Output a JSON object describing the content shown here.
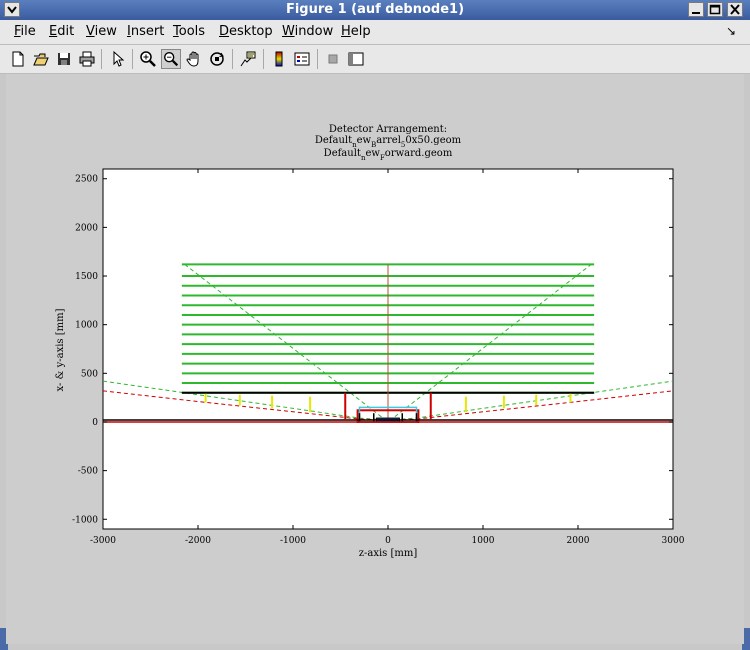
{
  "window": {
    "title": "Figure 1 (auf debnode1)",
    "menu_glyph": "❯",
    "min_glyph": "▁",
    "max_glyph": "☐",
    "close_glyph": "✕"
  },
  "menubar": {
    "items": [
      {
        "first": "F",
        "rest": "ile"
      },
      {
        "first": "E",
        "rest": "dit"
      },
      {
        "first": "V",
        "rest": "iew"
      },
      {
        "first": "I",
        "rest": "nsert"
      },
      {
        "first": "T",
        "rest": "ools"
      },
      {
        "first": "D",
        "rest": "esktop"
      },
      {
        "first": "W",
        "rest": "indow"
      },
      {
        "first": "H",
        "rest": "elp"
      }
    ],
    "dock_glyph": "↘"
  },
  "toolbar": {
    "icons": [
      "new-file-icon",
      "open-file-icon",
      "save-icon",
      "print-icon",
      "pointer-icon",
      "zoom-in-icon",
      "zoom-out-icon",
      "pan-hand-icon",
      "rotate-3d-icon",
      "data-cursor-icon",
      "colorbar-icon",
      "legend-icon",
      "hide-tools-icon",
      "plot-tools-icon"
    ]
  },
  "plot": {
    "title_line1": "Detector Arrangement:",
    "title_line2_parts": [
      {
        "t": "Default"
      },
      {
        "t": "n",
        "sub": true
      },
      {
        "t": "ew"
      },
      {
        "t": "B",
        "sub": true
      },
      {
        "t": "arrel"
      },
      {
        "t": "5",
        "sub": true
      },
      {
        "t": "0x50.geom"
      }
    ],
    "title_line3_parts": [
      {
        "t": "Default"
      },
      {
        "t": "n",
        "sub": true
      },
      {
        "t": "ew"
      },
      {
        "t": "F",
        "sub": true
      },
      {
        "t": "orward.geom"
      }
    ],
    "xlabel": "z-axis [mm]",
    "ylabel": "x- & y-axis [mm]"
  },
  "chart_data": {
    "type": "line",
    "xlim": [
      -3000,
      3000
    ],
    "ylim": [
      -1100,
      2600
    ],
    "xticks": [
      -3000,
      -2000,
      -1000,
      0,
      1000,
      2000,
      3000
    ],
    "yticks": [
      -1000,
      -500,
      0,
      500,
      1000,
      1500,
      2000,
      2500
    ],
    "grid": false,
    "colors": {
      "barrel_layers": "#2db82d",
      "support_base": "#000000",
      "beam_axis_red": "#cc0000",
      "beam_axis_black": "#000000",
      "center_line": "#b05030",
      "dashed_green": "#2db82d",
      "dashed_red": "#cc0000",
      "yellow_ticks": "#e8e800",
      "cyan_box": "#40c8e0"
    },
    "barrel_layers": {
      "z_range": [
        -2170,
        2170
      ],
      "radii": [
        300,
        400,
        500,
        600,
        700,
        800,
        900,
        1000,
        1100,
        1200,
        1300,
        1400,
        1500,
        1620
      ]
    },
    "center_line": {
      "z": 0,
      "y_range": [
        20,
        1620
      ]
    },
    "support_base": {
      "z_range": [
        -2170,
        2170
      ],
      "y": 300
    },
    "beam_lines": [
      {
        "color": "red",
        "y": 0
      },
      {
        "color": "black",
        "y": 20
      }
    ],
    "dashed_curves": [
      {
        "color": "green",
        "points": [
          [
            -3000,
            420
          ],
          [
            -2000,
            280
          ],
          [
            -1000,
            140
          ],
          [
            -300,
            40
          ],
          [
            0,
            20
          ],
          [
            300,
            40
          ],
          [
            1000,
            140
          ],
          [
            2000,
            280
          ],
          [
            3000,
            420
          ]
        ]
      },
      {
        "color": "red",
        "points": [
          [
            -3000,
            320
          ],
          [
            -2000,
            210
          ],
          [
            -1000,
            105
          ],
          [
            -300,
            30
          ],
          [
            0,
            15
          ],
          [
            300,
            30
          ],
          [
            1000,
            105
          ],
          [
            2000,
            210
          ],
          [
            3000,
            320
          ]
        ]
      },
      {
        "color": "green",
        "points": [
          [
            -2140,
            1620
          ],
          [
            0,
            0
          ],
          [
            2140,
            1620
          ]
        ]
      }
    ],
    "forward_disks": [
      {
        "z": -1920,
        "y_range": [
          200,
          290
        ],
        "color": "yellow"
      },
      {
        "z": -1560,
        "y_range": [
          170,
          280
        ],
        "color": "yellow"
      },
      {
        "z": -1220,
        "y_range": [
          140,
          270
        ],
        "color": "yellow"
      },
      {
        "z": -820,
        "y_range": [
          100,
          260
        ],
        "color": "yellow"
      },
      {
        "z": -450,
        "y_range": [
          30,
          300
        ],
        "color": "red"
      },
      {
        "z": 450,
        "y_range": [
          30,
          300
        ],
        "color": "red"
      },
      {
        "z": 820,
        "y_range": [
          100,
          260
        ],
        "color": "yellow"
      },
      {
        "z": 1220,
        "y_range": [
          140,
          270
        ],
        "color": "yellow"
      },
      {
        "z": 1560,
        "y_range": [
          170,
          280
        ],
        "color": "yellow"
      },
      {
        "z": 1920,
        "y_range": [
          200,
          290
        ],
        "color": "yellow"
      }
    ],
    "inner_detector": {
      "cyan_box": {
        "z_range": [
          -300,
          300
        ],
        "y_range": [
          0,
          150
        ]
      },
      "red_box": {
        "z_range": [
          -320,
          320
        ],
        "y_range": [
          0,
          120
        ]
      },
      "blue_core": {
        "z_range": [
          -120,
          120
        ],
        "y_range": [
          0,
          40
        ]
      },
      "inner_ticks_z": [
        -300,
        -150,
        150,
        300
      ]
    }
  }
}
